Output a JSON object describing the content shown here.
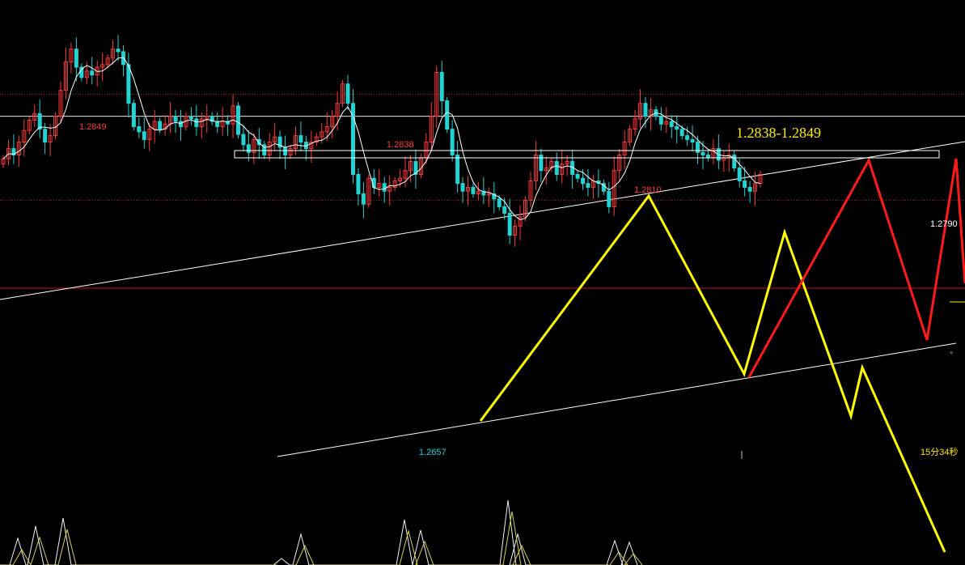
{
  "chart_data": {
    "type": "candlestick",
    "title": "",
    "labels": {
      "high_1": "1.2849",
      "high_2": "1.2838",
      "high_3": "1.2810",
      "low_1": "1.2657",
      "right_price": "1.2790",
      "zone": "1.2838-1.2849",
      "countdown": "15分34秒"
    },
    "resistance_zone": [
      1.2838,
      1.2849
    ],
    "levels": {
      "price_line": 1.279,
      "dotted_upper": 1.2807,
      "dotted_lower": 1.2725,
      "red_base": 1.2657
    },
    "ylim": [
      1.265,
      1.288
    ],
    "colors": {
      "up": "#ff3838",
      "down": "#22d3d3",
      "ma": "#ffffff",
      "projection_yellow": "#ffff00",
      "projection_red": "#ff1a1a",
      "level_red": "#c81414",
      "indicator": "#f0f0f0",
      "indicator2": "#d6d24a"
    },
    "closes": [
      1.2757,
      1.2765,
      1.276,
      1.277,
      1.2779,
      1.2787,
      1.2792,
      1.278,
      1.277,
      1.2775,
      1.279,
      1.281,
      1.2832,
      1.2842,
      1.2828,
      1.282,
      1.2825,
      1.2822,
      1.2828,
      1.283,
      1.2835,
      1.2842,
      1.284,
      1.283,
      1.28,
      1.2782,
      1.2778,
      1.2772,
      1.278,
      1.2786,
      1.278,
      1.2784,
      1.279,
      1.2786,
      1.2782,
      1.279,
      1.2788,
      1.2782,
      1.2788,
      1.279,
      1.2786,
      1.2782,
      1.2786,
      1.2784,
      1.2798,
      1.2776,
      1.2768,
      1.2762,
      1.2772,
      1.2768,
      1.276,
      1.277,
      1.2774,
      1.2766,
      1.276,
      1.2765,
      1.2775,
      1.277,
      1.2765,
      1.277,
      1.2774,
      1.2778,
      1.2782,
      1.279,
      1.28,
      1.2815,
      1.28,
      1.2745,
      1.273,
      1.2722,
      1.2742,
      1.2735,
      1.2738,
      1.2732,
      1.2735,
      1.274,
      1.2742,
      1.2748,
      1.2755,
      1.2745,
      1.2758,
      1.277,
      1.279,
      1.2824,
      1.2802,
      1.278,
      1.276,
      1.2738,
      1.2732,
      1.2735,
      1.273,
      1.2732,
      1.2729,
      1.273,
      1.2726,
      1.272,
      1.2715,
      1.2698,
      1.2705,
      1.2712,
      1.2725,
      1.274,
      1.276,
      1.2748,
      1.275,
      1.2755,
      1.2745,
      1.2753,
      1.2755,
      1.2745,
      1.2742,
      1.2738,
      1.2735,
      1.274,
      1.2738,
      1.2732,
      1.272,
      1.2748,
      1.276,
      1.277,
      1.278,
      1.2788,
      1.28,
      1.279,
      1.2795,
      1.279,
      1.2784,
      1.2786,
      1.2782,
      1.278,
      1.2775,
      1.2772,
      1.277,
      1.2762,
      1.276,
      1.2758,
      1.2765,
      1.2756,
      1.2758,
      1.276,
      1.275,
      1.274,
      1.2735,
      1.2732,
      1.2738,
      1.2745
    ]
  }
}
